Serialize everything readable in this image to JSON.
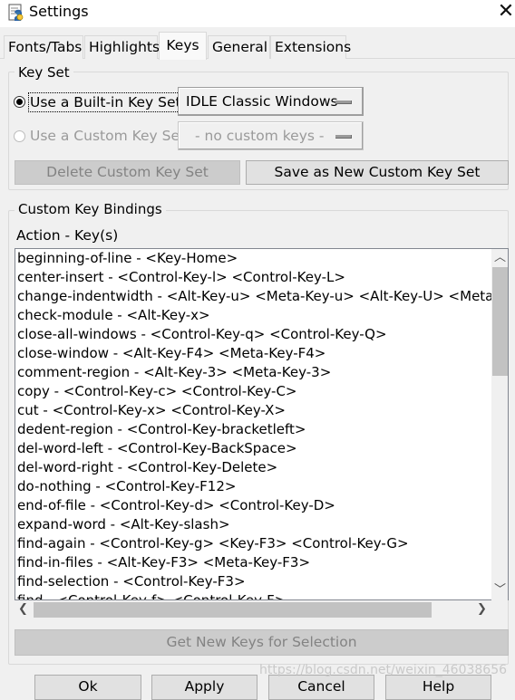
{
  "window": {
    "title": "Settings",
    "icon": "python-idle-icon"
  },
  "tabs": [
    {
      "label": "Fonts/Tabs"
    },
    {
      "label": "Highlights"
    },
    {
      "label": "Keys",
      "active": true
    },
    {
      "label": "General"
    },
    {
      "label": "Extensions"
    }
  ],
  "key_set": {
    "legend": "Key Set",
    "builtin_label": "Use a Built-in Key Set",
    "builtin_selected": true,
    "builtin_value": "IDLE Classic Windows",
    "custom_label": "Use a Custom Key Set",
    "custom_value": "- no custom keys -",
    "delete_label": "Delete Custom Key Set",
    "save_label": "Save as New Custom Key Set"
  },
  "bindings": {
    "legend": "Custom Key Bindings",
    "header": "Action - Key(s)",
    "items": [
      "beginning-of-line - <Key-Home>",
      "center-insert - <Control-Key-l> <Control-Key-L>",
      "change-indentwidth - <Alt-Key-u> <Meta-Key-u> <Alt-Key-U> <Meta-",
      "check-module - <Alt-Key-x>",
      "close-all-windows - <Control-Key-q> <Control-Key-Q>",
      "close-window - <Alt-Key-F4> <Meta-Key-F4>",
      "comment-region - <Alt-Key-3> <Meta-Key-3>",
      "copy - <Control-Key-c> <Control-Key-C>",
      "cut - <Control-Key-x> <Control-Key-X>",
      "dedent-region - <Control-Key-bracketleft>",
      "del-word-left - <Control-Key-BackSpace>",
      "del-word-right - <Control-Key-Delete>",
      "do-nothing - <Control-Key-F12>",
      "end-of-file - <Control-Key-d> <Control-Key-D>",
      "expand-word - <Alt-Key-slash>",
      "find-again - <Control-Key-g> <Key-F3> <Control-Key-G>",
      "find-in-files - <Alt-Key-F3> <Meta-Key-F3>",
      "find-selection - <Control-Key-F3>",
      "find - <Control-Key-f> <Control-Key-F>"
    ],
    "get_new_keys_label": "Get New Keys for Selection"
  },
  "footer": {
    "ok_label": "Ok",
    "apply_label": "Apply",
    "cancel_label": "Cancel",
    "help_label": "Help"
  },
  "watermark": "https://blog.csdn.net/weixin_46038656"
}
